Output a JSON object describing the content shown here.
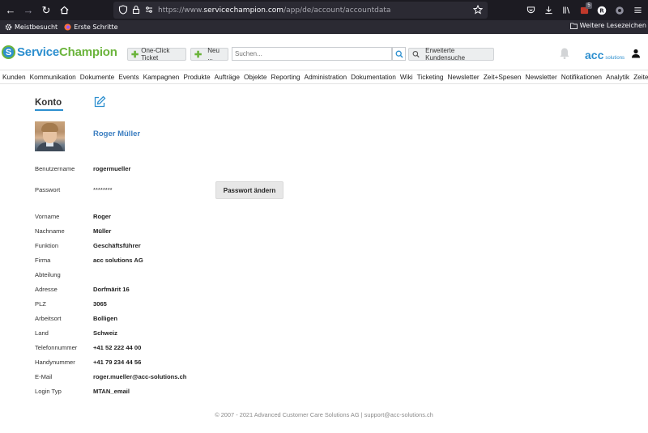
{
  "browser": {
    "url_prefix": "https://www.",
    "url_domain": "servicechampion.com",
    "url_path": "/app/de/account/accountdata",
    "bookmarks": [
      {
        "label": "Meistbesucht",
        "icon": "gear-icon"
      },
      {
        "label": "Erste Schritte",
        "icon": "firefox-icon"
      }
    ],
    "other_bookmarks": "Weitere Lesezeichen",
    "extension_badge": "5"
  },
  "header": {
    "logo_service": "Service",
    "logo_champion": "Champion",
    "one_click_ticket": "One-Click Ticket",
    "new_label": "Neu ...",
    "search_placeholder": "Suchen...",
    "advanced_search": "Erweiterte Kundensuche",
    "acc_brand": "acc",
    "acc_solutions": "solutions"
  },
  "menu": [
    "Kunden",
    "Kommunikation",
    "Dokumente",
    "Events",
    "Kampagnen",
    "Produkte",
    "Aufträge",
    "Objekte",
    "Reporting",
    "Administration",
    "Dokumentation",
    "Wiki",
    "Ticketing",
    "Newsletter",
    "Zeit+Spesen",
    "Newsletter",
    "Notifikationen",
    "Analytik",
    "Zeiterfassung"
  ],
  "account": {
    "title": "Konto",
    "full_name": "Roger Müller",
    "change_password": "Passwort ändern",
    "fields": [
      {
        "label": "Benutzername",
        "value": "rogermueller"
      },
      {
        "label": "Passwort",
        "value": "********"
      },
      {
        "label": "Vorname",
        "value": "Roger"
      },
      {
        "label": "Nachname",
        "value": "Müller"
      },
      {
        "label": "Funktion",
        "value": "Geschäftsführer"
      },
      {
        "label": "Firma",
        "value": "acc solutions AG"
      },
      {
        "label": "Abteilung",
        "value": ""
      },
      {
        "label": "Adresse",
        "value": "Dorfmärit 16"
      },
      {
        "label": "PLZ",
        "value": "3065"
      },
      {
        "label": "Arbeitsort",
        "value": "Bolligen"
      },
      {
        "label": "Land",
        "value": "Schweiz"
      },
      {
        "label": "Telefonnummer",
        "value": "+41 52 222 44 00"
      },
      {
        "label": "Handynummer",
        "value": "+41 79 234 44 56"
      },
      {
        "label": "E-Mail",
        "value": "roger.mueller@acc-solutions.ch"
      },
      {
        "label": "Login Typ",
        "value": "MTAN_email"
      }
    ]
  },
  "footer": "© 2007 - 2021  Advanced Customer Care Solutions AG | support@acc-solutions.ch"
}
